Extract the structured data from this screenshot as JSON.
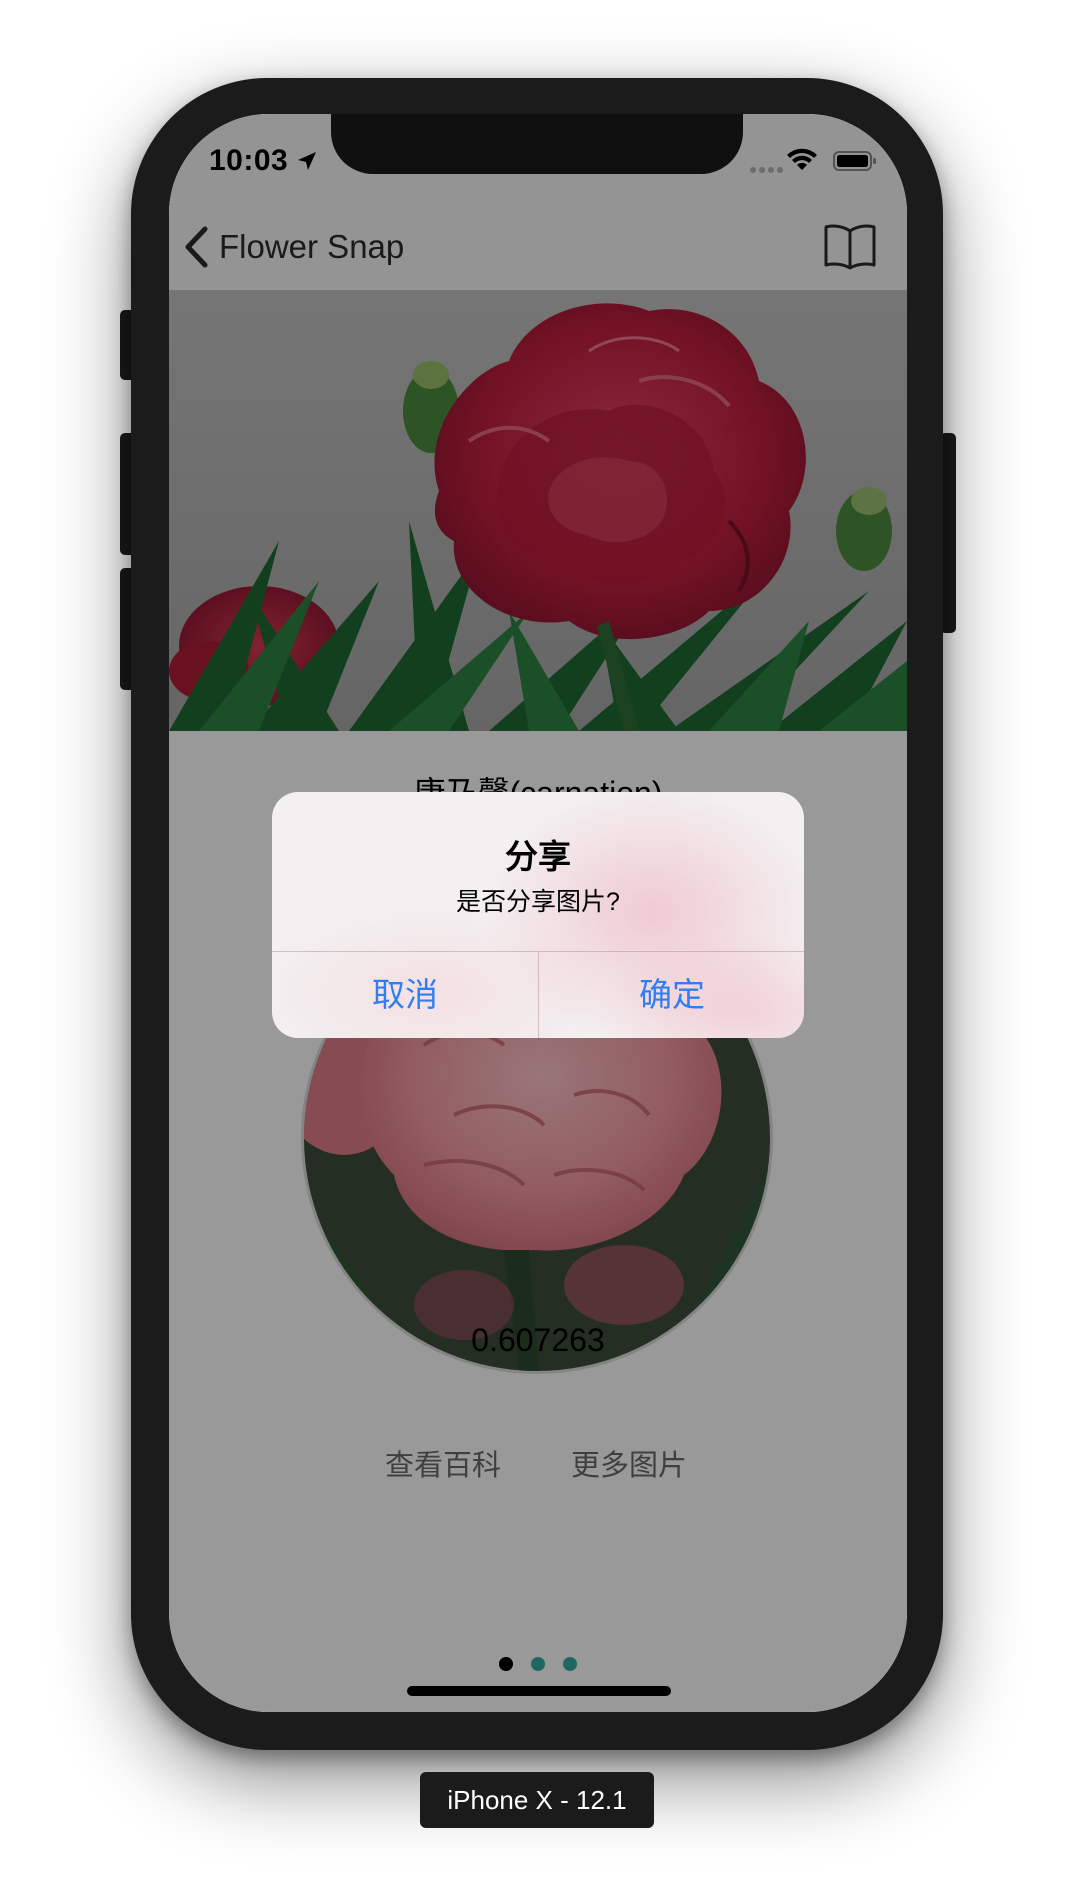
{
  "status_bar": {
    "time": "10:03"
  },
  "nav": {
    "back_label": "Flower Snap"
  },
  "result": {
    "flower_name": "康乃馨(carnation)",
    "score": "0.607263",
    "wiki_link": "查看百科",
    "more_images_link": "更多图片"
  },
  "pager": {
    "page_count": 3,
    "current_page": 1,
    "active_color": "#000000",
    "inactive_color": "#3aa8a8"
  },
  "alert": {
    "title": "分享",
    "message": "是否分享图片?",
    "cancel_label": "取消",
    "confirm_label": "确定",
    "button_color": "#2f7ff2"
  },
  "simulator": {
    "device_label": "iPhone X - 12.1"
  }
}
